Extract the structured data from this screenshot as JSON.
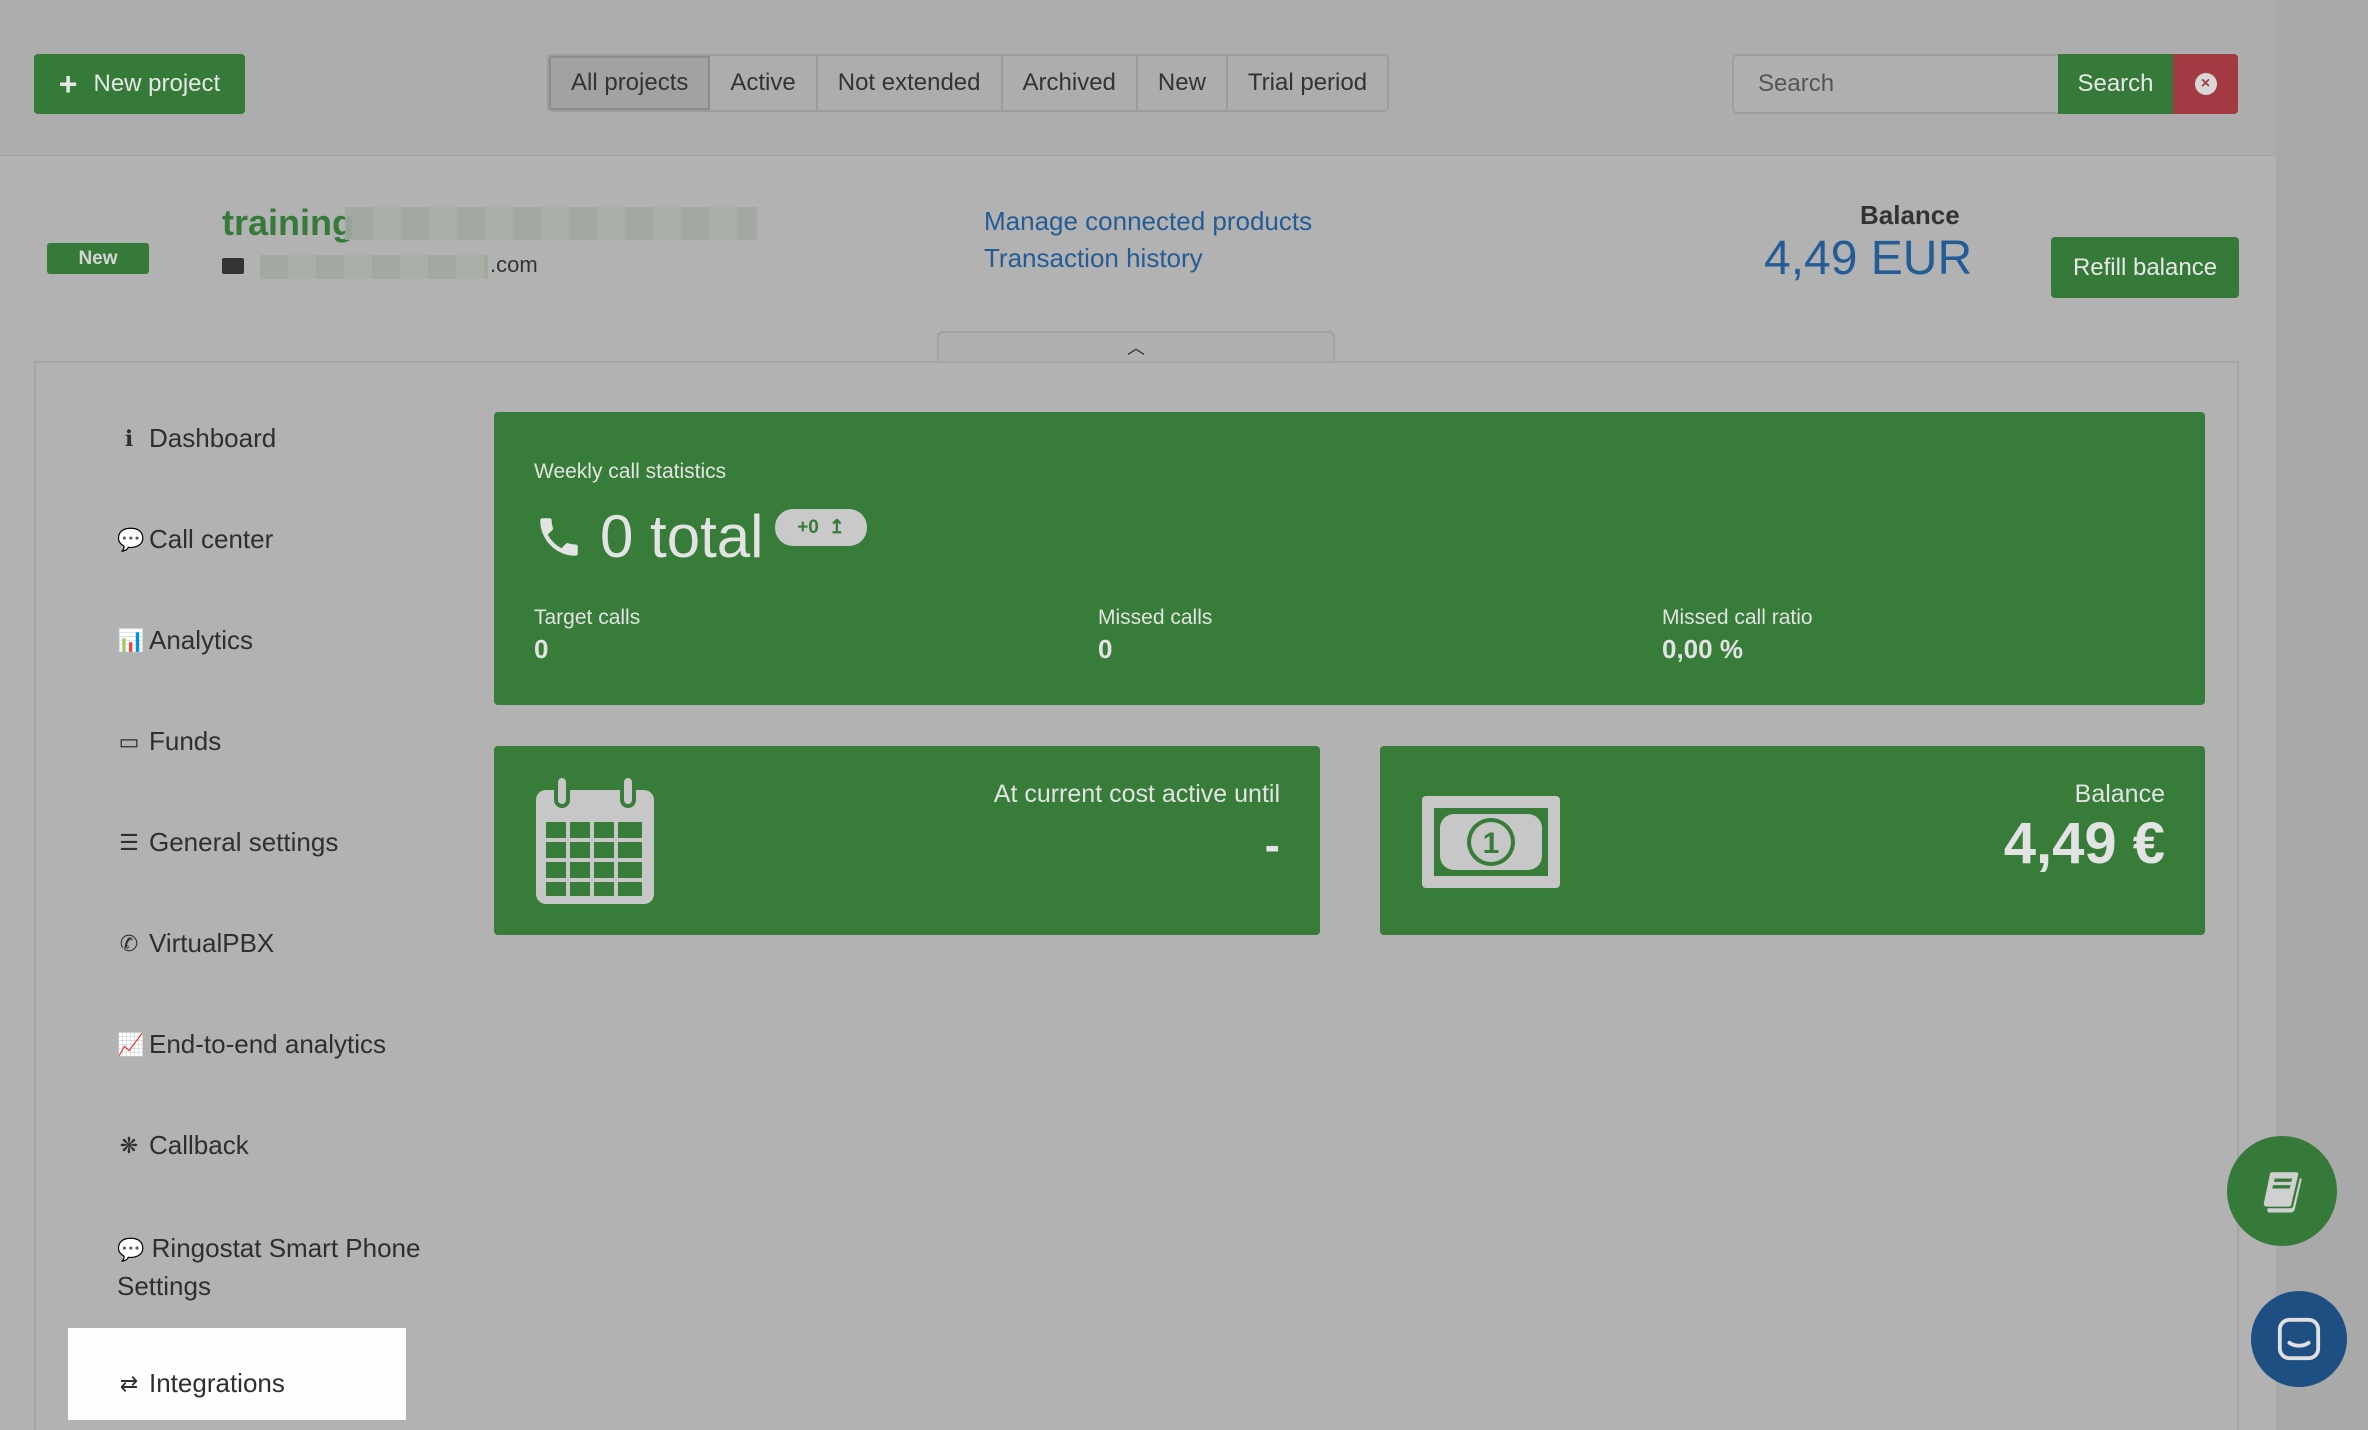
{
  "toolbar": {
    "new_project_label": "New project",
    "filters": [
      {
        "label": "All projects",
        "active": true
      },
      {
        "label": "Active",
        "active": false
      },
      {
        "label": "Not extended",
        "active": false
      },
      {
        "label": "Archived",
        "active": false
      },
      {
        "label": "New",
        "active": false
      },
      {
        "label": "Trial period",
        "active": false
      }
    ],
    "search_placeholder": "Search",
    "search_button": "Search"
  },
  "project": {
    "badge": "New",
    "name_visible": "training",
    "email_suffix": ".com",
    "links": {
      "manage_products": "Manage connected products",
      "transaction_history": "Transaction history"
    },
    "balance_label": "Balance",
    "balance_value": "4,49 EUR",
    "refill_label": "Refill balance"
  },
  "sidebar": {
    "items": [
      {
        "label": "Dashboard",
        "icon": "info-icon"
      },
      {
        "label": "Call center",
        "icon": "comment-icon"
      },
      {
        "label": "Analytics",
        "icon": "bar-chart-icon"
      },
      {
        "label": "Funds",
        "icon": "credit-card-icon"
      },
      {
        "label": "General settings",
        "icon": "sliders-icon"
      },
      {
        "label": "VirtualPBX",
        "icon": "phone-icon"
      },
      {
        "label": "End-to-end analytics",
        "icon": "line-chart-icon"
      },
      {
        "label": "Callback",
        "icon": "wechat-icon"
      },
      {
        "label": "Ringostat Smart Phone Settings",
        "icon": "comments-icon"
      },
      {
        "label": "Integrations",
        "icon": "exchange-icon",
        "active": true
      }
    ]
  },
  "weekly": {
    "title": "Weekly call statistics",
    "total": "0 total",
    "delta": "+0",
    "stats": [
      {
        "label": "Target calls",
        "value": "0"
      },
      {
        "label": "Missed calls",
        "value": "0"
      },
      {
        "label": "Missed call ratio",
        "value": "0,00 %"
      }
    ]
  },
  "cost_card": {
    "label": "At current cost active until",
    "value": "-"
  },
  "balance_card": {
    "label": "Balance",
    "value": "4,49 €"
  },
  "colors": {
    "green": "#357a38",
    "link_blue": "#245c95",
    "danger": "#a33a43"
  }
}
